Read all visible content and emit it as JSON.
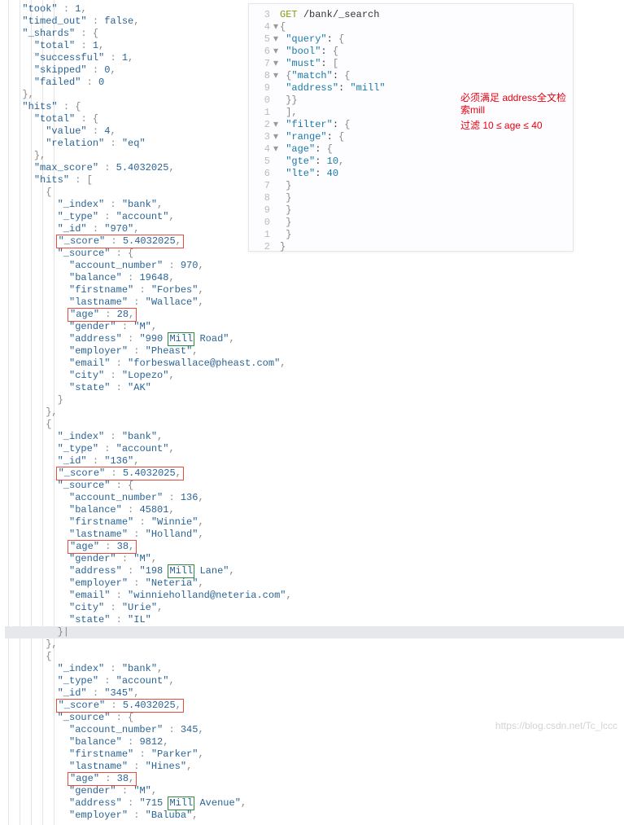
{
  "response": {
    "took": 1,
    "timed_out": false,
    "shards": {
      "total": 1,
      "successful": 1,
      "skipped": 0,
      "failed": 0
    },
    "hits": {
      "total": {
        "value": 4,
        "relation": "eq"
      },
      "max_score": 5.4032025,
      "items": [
        {
          "_index": "bank",
          "_type": "account",
          "_id": "970",
          "_score": 5.4032025,
          "_source": {
            "account_number": 970,
            "balance": 19648,
            "firstname": "Forbes",
            "lastname": "Wallace",
            "age": 28,
            "gender": "M",
            "address_prefix": "990 ",
            "address_mill": "Mill",
            "address_suffix": " Road",
            "employer": "Pheast",
            "email": "forbeswallace@pheast.com",
            "city": "Lopezo",
            "state": "AK"
          }
        },
        {
          "_index": "bank",
          "_type": "account",
          "_id": "136",
          "_score": 5.4032025,
          "_source": {
            "account_number": 136,
            "balance": 45801,
            "firstname": "Winnie",
            "lastname": "Holland",
            "age": 38,
            "gender": "M",
            "address_prefix": "198 ",
            "address_mill": "Mill",
            "address_suffix": " Lane",
            "employer": "Neteria",
            "email": "winnieholland@neteria.com",
            "city": "Urie",
            "state": "IL"
          }
        },
        {
          "_index": "bank",
          "_type": "account",
          "_id": "345",
          "_score": 5.4032025,
          "_source": {
            "account_number": 345,
            "balance": 9812,
            "firstname": "Parker",
            "lastname": "Hines",
            "age": 38,
            "gender": "M",
            "address_prefix": "715 ",
            "address_mill": "Mill",
            "address_suffix": " Avenue",
            "employer": "Baluba"
          }
        }
      ]
    }
  },
  "query_panel": {
    "method": "GET",
    "path": "/bank/_search",
    "lines": {
      "query": "\"query\"",
      "bool": "\"bool\"",
      "must": "\"must\"",
      "match": "\"match\"",
      "address_key": "\"address\"",
      "address_val": "\"mill\"",
      "filter": "\"filter\"",
      "range": "\"range\"",
      "age_key": "\"age\"",
      "gte_key": "\"gte\"",
      "gte_val": 10,
      "lte_key": "\"lte\"",
      "lte_val": 40
    },
    "annotations": {
      "must": "必须满足 address全文检索mill",
      "filter": "过滤   10 ≤ age ≤ 40"
    }
  },
  "labels": {
    "took": "\"took\"",
    "timed_out": "\"timed_out\"",
    "shards": "\"_shards\"",
    "total": "\"total\"",
    "successful": "\"successful\"",
    "skipped": "\"skipped\"",
    "failed": "\"failed\"",
    "hits": "\"hits\"",
    "value": "\"value\"",
    "relation": "\"relation\"",
    "max_score": "\"max_score\"",
    "index": "\"_index\"",
    "type": "\"_type\"",
    "id": "\"_id\"",
    "score": "\"_score\"",
    "source": "\"_source\"",
    "account_number": "\"account_number\"",
    "balance": "\"balance\"",
    "firstname": "\"firstname\"",
    "lastname": "\"lastname\"",
    "age": "\"age\"",
    "gender": "\"gender\"",
    "address": "\"address\"",
    "employer": "\"employer\"",
    "email": "\"email\"",
    "city": "\"city\"",
    "state": "\"state\"",
    "false": "false"
  },
  "watermark": "https://blog.csdn.net/Tc_lccc"
}
